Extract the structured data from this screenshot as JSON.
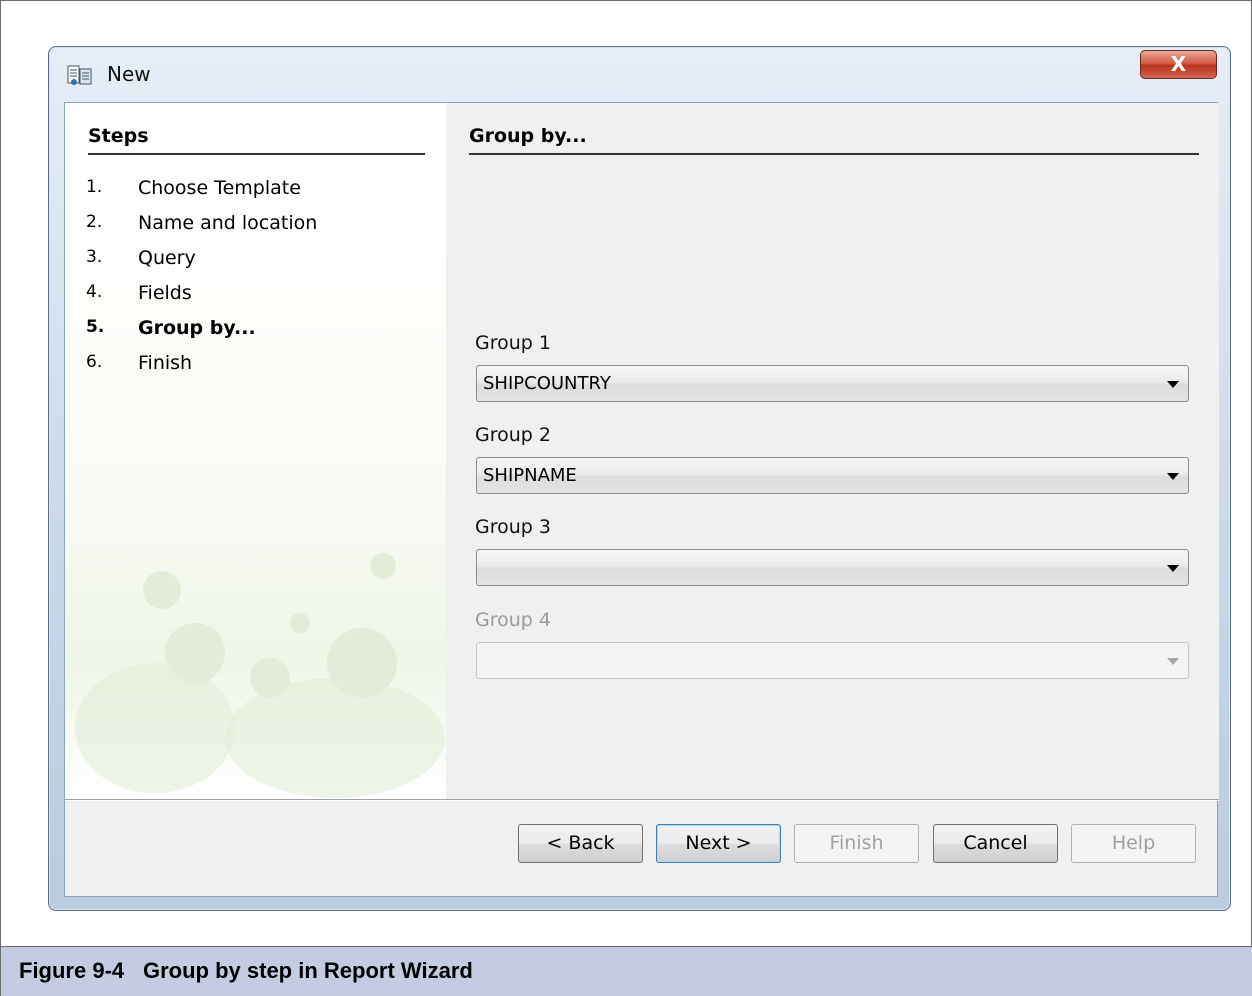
{
  "window": {
    "title": "New",
    "close_label": "X"
  },
  "steps": {
    "heading": "Steps",
    "items": [
      {
        "num": "1.",
        "label": "Choose Template"
      },
      {
        "num": "2.",
        "label": "Name and location"
      },
      {
        "num": "3.",
        "label": "Query"
      },
      {
        "num": "4.",
        "label": "Fields"
      },
      {
        "num": "5.",
        "label": "Group by..."
      },
      {
        "num": "6.",
        "label": "Finish"
      }
    ],
    "active_index": 4
  },
  "main": {
    "heading": "Group by...",
    "groups": [
      {
        "label": "Group 1",
        "value": "SHIPCOUNTRY",
        "enabled": true
      },
      {
        "label": "Group 2",
        "value": "SHIPNAME",
        "enabled": true
      },
      {
        "label": "Group 3",
        "value": "",
        "enabled": true
      },
      {
        "label": "Group 4",
        "value": "",
        "enabled": false
      }
    ]
  },
  "buttons": {
    "back": "< Back",
    "next": "Next >",
    "finish": "Finish",
    "cancel": "Cancel",
    "help": "Help"
  },
  "caption": {
    "number": "Figure 9-4",
    "text": "Group by step in Report Wizard"
  },
  "colors": {
    "caption_bg": "#c3cce0",
    "window_frame": "#c8d7e8",
    "close_button": "#d0523a"
  }
}
